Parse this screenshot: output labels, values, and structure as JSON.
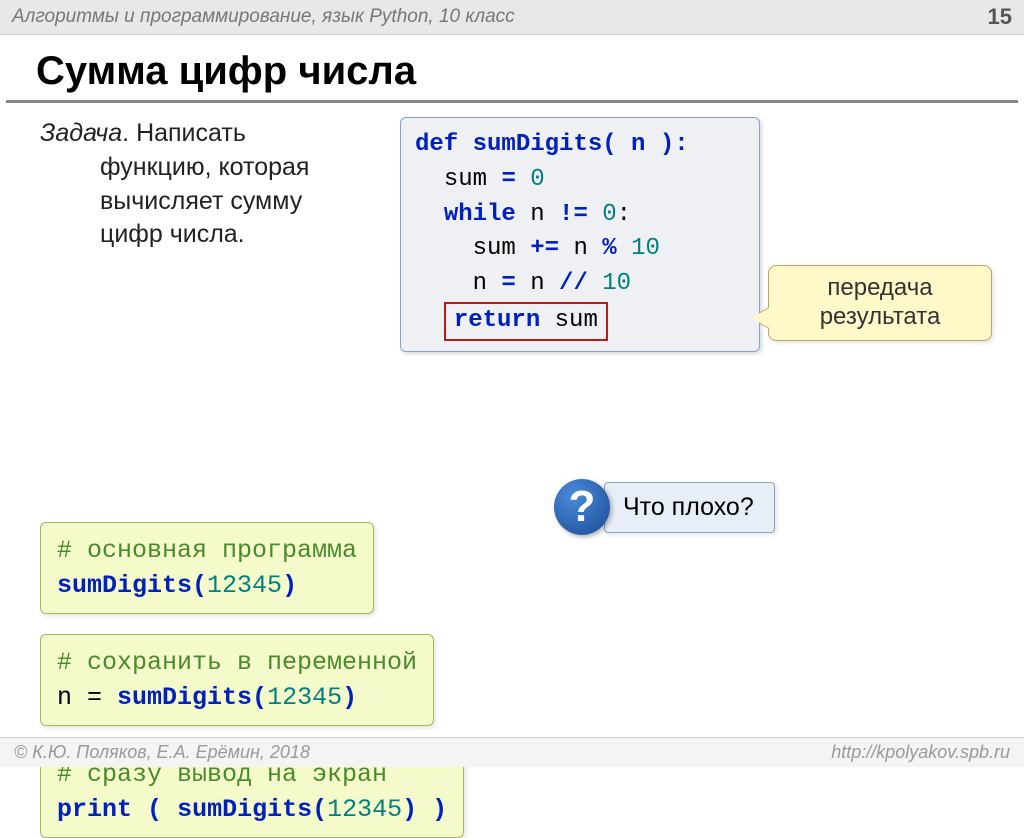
{
  "header": {
    "subject": "Алгоритмы и программирование, язык Python, 10 класс",
    "page": "15"
  },
  "title": "Сумма цифр числа",
  "task": {
    "label": "Задача",
    "text_lines": [
      "Написать",
      "функцию, которая",
      "вычисляет сумму",
      "цифр числа."
    ]
  },
  "code_main": {
    "l1_def": "def",
    "l1_fn": "sumDigits",
    "l1_rest": "( n ):",
    "l2_var": "sum",
    "l2_eq": "=",
    "l2_val": "0",
    "l3_while": "while",
    "l3_cond1": "n",
    "l3_neq": "!=",
    "l3_zero": "0",
    "l3_colon": ":",
    "l4_a": "sum",
    "l4_op": "+=",
    "l4_b": "n",
    "l4_mod": "%",
    "l4_ten": "10",
    "l5_a": "n",
    "l5_eq": "=",
    "l5_b": "n",
    "l5_div": "//",
    "l5_ten": "10",
    "l6_return": "return",
    "l6_val": "sum"
  },
  "callout": {
    "line1": "передача",
    "line2": "результата"
  },
  "box1": {
    "comment": "# основная программа",
    "fn": "sumDigits",
    "arg": "12345"
  },
  "box2": {
    "comment": "# сохранить в переменной",
    "var": "n = ",
    "fn": "sumDigits",
    "arg": "12345"
  },
  "box3": {
    "comment": "# сразу вывод на экран",
    "print": "print",
    "fn": "sumDigits",
    "arg": "12345"
  },
  "question": {
    "mark": "?",
    "text": "Что плохо?"
  },
  "footer": {
    "left": "© К.Ю. Поляков, Е.А. Ерёмин, 2018",
    "right": "http://kpolyakov.spb.ru"
  }
}
